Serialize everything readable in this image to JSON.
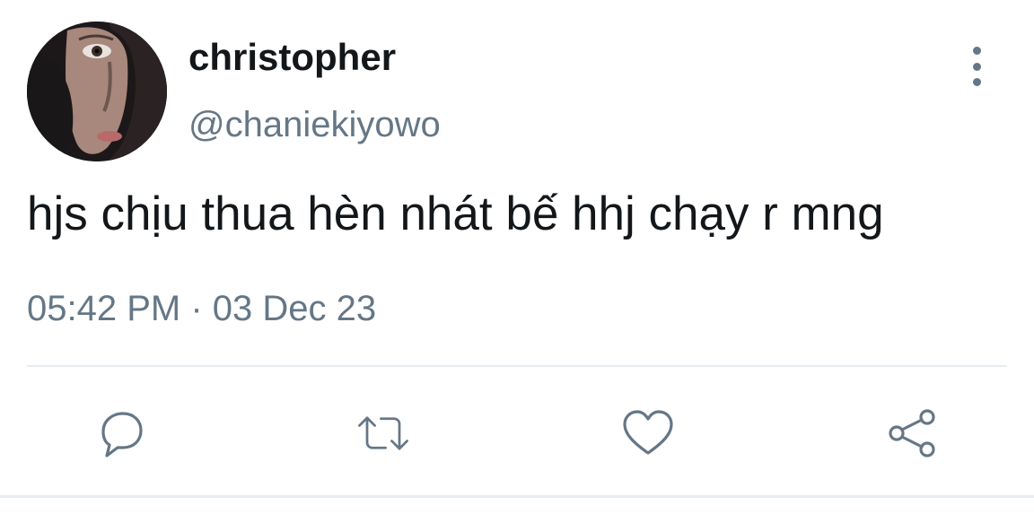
{
  "tweet": {
    "display_name": "christopher",
    "handle": "@chaniekiyowo",
    "text": "hjs chịu thua hèn nhát bế hhj chạy r mng",
    "time": "05:42 PM",
    "separator": "·",
    "date": "03 Dec 23"
  },
  "icons": {
    "more": "more-vertical-icon",
    "reply": "reply-icon",
    "retweet": "retweet-icon",
    "like": "heart-icon",
    "share": "share-icon"
  },
  "colors": {
    "text": "#14171a",
    "secondary": "#657786",
    "divider": "#e6ecf0",
    "background": "#ffffff"
  }
}
